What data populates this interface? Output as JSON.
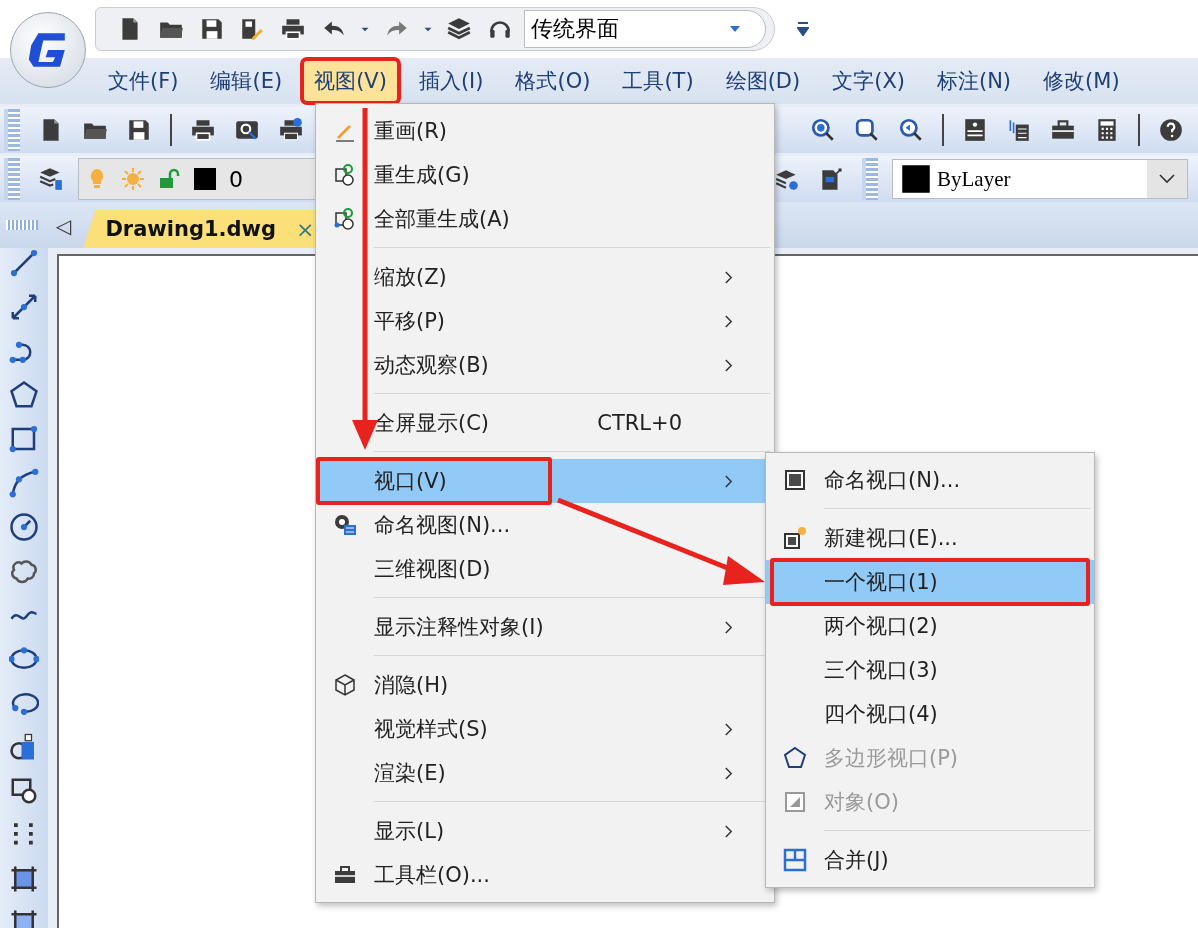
{
  "workspace": {
    "value": "传统界面"
  },
  "menu_bar": [
    {
      "label": "文件(F)",
      "selected": false,
      "annotated": false
    },
    {
      "label": "编辑(E)",
      "selected": false,
      "annotated": false
    },
    {
      "label": "视图(V)",
      "selected": true,
      "annotated": true
    },
    {
      "label": "插入(I)",
      "selected": false,
      "annotated": false
    },
    {
      "label": "格式(O)",
      "selected": false,
      "annotated": false
    },
    {
      "label": "工具(T)",
      "selected": false,
      "annotated": false
    },
    {
      "label": "绘图(D)",
      "selected": false,
      "annotated": false
    },
    {
      "label": "文字(X)",
      "selected": false,
      "annotated": false
    },
    {
      "label": "标注(N)",
      "selected": false,
      "annotated": false
    },
    {
      "label": "修改(M)",
      "selected": false,
      "annotated": false
    }
  ],
  "layer_control": {
    "value": "0"
  },
  "color_control": {
    "value": "ByLayer"
  },
  "document_tab": {
    "label": "Drawing1.dwg",
    "close": "×",
    "prev": "◁"
  },
  "view_menu": [
    {
      "kind": "item",
      "label": "重画(R)",
      "submenu": false,
      "selected": false,
      "annotated": false
    },
    {
      "kind": "item",
      "label": "重生成(G)",
      "submenu": false,
      "selected": false,
      "annotated": false
    },
    {
      "kind": "item",
      "label": "全部重生成(A)",
      "submenu": false,
      "selected": false,
      "annotated": false
    },
    {
      "kind": "separator"
    },
    {
      "kind": "item",
      "label": "缩放(Z)",
      "submenu": true,
      "selected": false,
      "annotated": false
    },
    {
      "kind": "item",
      "label": "平移(P)",
      "submenu": true,
      "selected": false,
      "annotated": false
    },
    {
      "kind": "item",
      "label": "动态观察(B)",
      "submenu": true,
      "selected": false,
      "annotated": false
    },
    {
      "kind": "separator"
    },
    {
      "kind": "item",
      "label": "全屏显示(C)",
      "shortcut": "CTRL+0",
      "submenu": false,
      "selected": false,
      "annotated": false
    },
    {
      "kind": "separator"
    },
    {
      "kind": "item",
      "label": "视口(V)",
      "submenu": true,
      "selected": true,
      "annotated": true
    },
    {
      "kind": "item",
      "label": "命名视图(N)...",
      "submenu": false,
      "selected": false,
      "annotated": false
    },
    {
      "kind": "item",
      "label": "三维视图(D)",
      "submenu": false,
      "selected": false,
      "annotated": false
    },
    {
      "kind": "separator"
    },
    {
      "kind": "item",
      "label": "显示注释性对象(I)",
      "submenu": true,
      "selected": false,
      "annotated": false
    },
    {
      "kind": "separator"
    },
    {
      "kind": "item",
      "label": "消隐(H)",
      "submenu": false,
      "selected": false,
      "annotated": false
    },
    {
      "kind": "item",
      "label": "视觉样式(S)",
      "submenu": true,
      "selected": false,
      "annotated": false
    },
    {
      "kind": "item",
      "label": "渲染(E)",
      "submenu": true,
      "selected": false,
      "annotated": false
    },
    {
      "kind": "separator"
    },
    {
      "kind": "item",
      "label": "显示(L)",
      "submenu": true,
      "selected": false,
      "annotated": false
    },
    {
      "kind": "item",
      "label": "工具栏(O)...",
      "submenu": false,
      "selected": false,
      "annotated": false
    }
  ],
  "viewport_submenu": [
    {
      "kind": "item",
      "label": "命名视口(N)...",
      "selected": false,
      "disabled": false,
      "annotated": false
    },
    {
      "kind": "separator"
    },
    {
      "kind": "item",
      "label": "新建视口(E)...",
      "selected": false,
      "disabled": false,
      "annotated": false
    },
    {
      "kind": "item",
      "label": "一个视口(1)",
      "selected": true,
      "disabled": false,
      "annotated": true
    },
    {
      "kind": "item",
      "label": "两个视口(2)",
      "selected": false,
      "disabled": false,
      "annotated": false
    },
    {
      "kind": "item",
      "label": "三个视口(3)",
      "selected": false,
      "disabled": false,
      "annotated": false
    },
    {
      "kind": "item",
      "label": "四个视口(4)",
      "selected": false,
      "disabled": false,
      "annotated": false
    },
    {
      "kind": "item",
      "label": "多边形视口(P)",
      "selected": false,
      "disabled": true,
      "annotated": false
    },
    {
      "kind": "item",
      "label": "对象(O)",
      "selected": false,
      "disabled": true,
      "annotated": false
    },
    {
      "kind": "separator"
    },
    {
      "kind": "item",
      "label": "合并(J)",
      "selected": false,
      "disabled": false,
      "annotated": false
    }
  ]
}
